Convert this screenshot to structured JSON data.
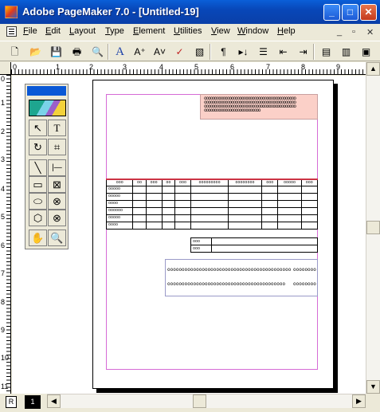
{
  "window": {
    "title": "Adobe PageMaker 7.0 - [Untitled-19]",
    "minimize_glyph": "_",
    "maximize_glyph": "□",
    "close_glyph": "✕"
  },
  "menubar": {
    "items": [
      {
        "accel": "F",
        "rest": "ile"
      },
      {
        "accel": "E",
        "rest": "dit"
      },
      {
        "accel": "L",
        "rest": "ayout"
      },
      {
        "accel": "T",
        "rest": "ype"
      },
      {
        "accel": "E",
        "rest": "lement"
      },
      {
        "accel": "U",
        "rest": "tilities"
      },
      {
        "accel": "V",
        "rest": "iew"
      },
      {
        "accel": "W",
        "rest": "indow"
      },
      {
        "accel": "H",
        "rest": "elp"
      }
    ],
    "doc_minimize": "_",
    "doc_restore": "▫",
    "doc_close": "✕"
  },
  "toolbar": {
    "buttons": [
      {
        "name": "new-icon",
        "glyph": "🗋"
      },
      {
        "name": "open-icon",
        "glyph": "📂"
      },
      {
        "name": "save-icon",
        "glyph": "💾"
      },
      {
        "name": "print-icon",
        "glyph": "🖶"
      },
      {
        "name": "find-icon",
        "glyph": "🔍"
      },
      {
        "name": "type-a-icon",
        "glyph": "A"
      },
      {
        "name": "font-size-up-icon",
        "glyph": "A⁺"
      },
      {
        "name": "font-size-down-icon",
        "glyph": "A˅"
      },
      {
        "name": "spelling-icon",
        "glyph": "✓"
      },
      {
        "name": "fill-icon",
        "glyph": "▧"
      },
      {
        "name": "paragraph-icon",
        "glyph": "¶"
      },
      {
        "name": "indent-tab-icon",
        "glyph": "▸↓"
      },
      {
        "name": "bullets-icon",
        "glyph": "☰"
      },
      {
        "name": "decrease-indent-icon",
        "glyph": "⇤"
      },
      {
        "name": "increase-indent-icon",
        "glyph": "⇥"
      },
      {
        "name": "styles-icon",
        "glyph": "▤"
      },
      {
        "name": "colors-icon",
        "glyph": "▥"
      },
      {
        "name": "library-icon",
        "glyph": "▣"
      }
    ]
  },
  "ruler_top": {
    "labels": [
      "0",
      "1",
      "2",
      "3",
      "4",
      "5",
      "6",
      "7",
      "8",
      "9"
    ]
  },
  "ruler_left": {
    "labels": [
      "0",
      "1",
      "2",
      "3",
      "4",
      "5",
      "6",
      "7",
      "8",
      "9",
      "10",
      "11"
    ]
  },
  "toolbox": {
    "tools": [
      {
        "name": "pointer-tool-icon",
        "glyph": "↖"
      },
      {
        "name": "text-tool-icon",
        "glyph": "T"
      },
      {
        "name": "rotate-tool-icon",
        "glyph": "↻"
      },
      {
        "name": "crop-tool-icon",
        "glyph": "⌗"
      },
      {
        "name": "line-tool-icon",
        "glyph": "╲"
      },
      {
        "name": "constrained-line-tool-icon",
        "glyph": "|—"
      },
      {
        "name": "rectangle-tool-icon",
        "glyph": "▭"
      },
      {
        "name": "rectangle-frame-tool-icon",
        "glyph": "⊠"
      },
      {
        "name": "ellipse-tool-icon",
        "glyph": "⬭"
      },
      {
        "name": "ellipse-frame-tool-icon",
        "glyph": "⊗"
      },
      {
        "name": "polygon-tool-icon",
        "glyph": "⬡"
      },
      {
        "name": "polygon-frame-tool-icon",
        "glyph": "⊗"
      },
      {
        "name": "hand-tool-icon",
        "glyph": "✋"
      },
      {
        "name": "zoom-tool-icon",
        "glyph": "🔍"
      }
    ]
  },
  "page_tabs": {
    "master": "R",
    "page1": "1"
  },
  "document": {
    "header_lines": [
      "oooooooooooooooooooooooooooooooooooooooooooo",
      "oooooooooooooooooooooooooooooooooooooooooooo",
      "oooooooooooooooooooooooooooooooooooooooooooo",
      "ooooooooooooooooooooooooooo"
    ],
    "table_header": [
      "ooo",
      "oo",
      "ooo",
      "oo",
      "ooo",
      "ooooooooo",
      "oooooooo",
      "ooo",
      "ooooo",
      "ooo"
    ],
    "table_rows": [
      [
        "ooooo",
        "",
        "",
        "",
        "",
        "",
        "",
        "",
        "",
        ""
      ],
      [
        "ooooo",
        "",
        "",
        "",
        "",
        "",
        "",
        "",
        "",
        ""
      ],
      [
        "oooo",
        "",
        "",
        "",
        "",
        "",
        "",
        "",
        "",
        ""
      ],
      [
        "oooooo",
        "",
        "",
        "",
        "",
        "",
        "",
        "",
        "",
        ""
      ],
      [
        "ooooo",
        "",
        "",
        "",
        "",
        "",
        "",
        "",
        "",
        ""
      ],
      [
        "oooo",
        "",
        "",
        "",
        "",
        "",
        "",
        "",
        "",
        ""
      ]
    ],
    "subtotal_rows": [
      [
        "ooo",
        ""
      ],
      [
        "ooo",
        ""
      ]
    ],
    "footer_line1_left": "ooooooooooooooooooooooooooooooooooooooooooo",
    "footer_line1_right": "oooooooo",
    "footer_line2_left": "ooooooooooooooooooooooooooooooooooooooooo",
    "footer_line2_right": "oooooooo"
  }
}
